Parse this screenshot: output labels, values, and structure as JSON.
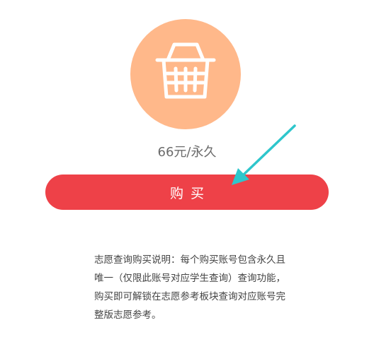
{
  "product": {
    "icon": "shopping-basket-icon",
    "price_text": "66元/永久"
  },
  "buy_button": {
    "label": "购买"
  },
  "annotation": {
    "icon": "arrow-pointer-icon",
    "color": "#2EC6CC"
  },
  "colors": {
    "circle_bg": "#FFB88A",
    "button_bg": "#EE4148",
    "text": "#444444"
  },
  "description": "志愿查询购买说明：每个购买账号包含永久且唯一（仅限此账号对应学生查询）查询功能，购买即可解锁在志愿参考板块查询对应账号完整版志愿参考。"
}
